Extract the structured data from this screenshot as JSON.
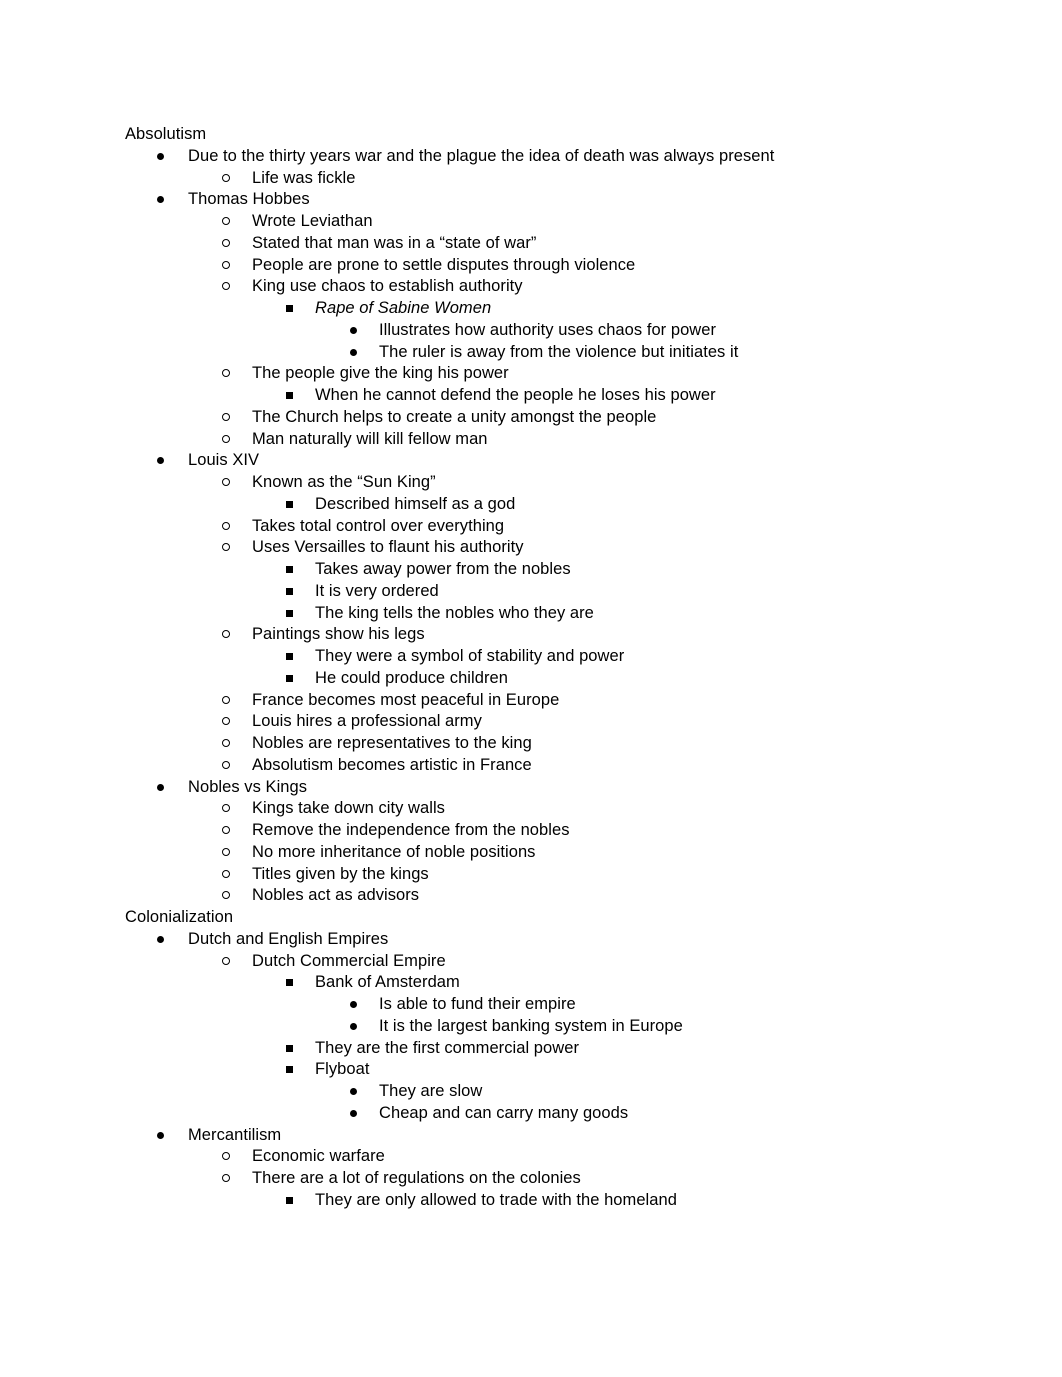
{
  "document": {
    "outline": [
      {
        "level": 0,
        "bullet": "none",
        "text": "Absolutism",
        "italic": false
      },
      {
        "level": 1,
        "bullet": "disc",
        "text": "Due to the thirty years war and the plague the idea of death was always present",
        "italic": false
      },
      {
        "level": 2,
        "bullet": "circle",
        "text": "Life was fickle",
        "italic": false
      },
      {
        "level": 1,
        "bullet": "disc",
        "text": "Thomas Hobbes",
        "italic": false
      },
      {
        "level": 2,
        "bullet": "circle",
        "text": "Wrote Leviathan",
        "italic": false
      },
      {
        "level": 2,
        "bullet": "circle",
        "text": "Stated that man was in a “state of war”",
        "italic": false
      },
      {
        "level": 2,
        "bullet": "circle",
        "text": "People are prone to settle disputes through violence",
        "italic": false
      },
      {
        "level": 2,
        "bullet": "circle",
        "text": "King use chaos to establish authority",
        "italic": false
      },
      {
        "level": 3,
        "bullet": "square",
        "text": "Rape of Sabine Women",
        "italic": true
      },
      {
        "level": 4,
        "bullet": "disc",
        "text": "Illustrates how authority uses chaos for power",
        "italic": false
      },
      {
        "level": 4,
        "bullet": "disc",
        "text": "The ruler is away from the violence but initiates it",
        "italic": false
      },
      {
        "level": 2,
        "bullet": "circle",
        "text": "The people give the king his power",
        "italic": false
      },
      {
        "level": 3,
        "bullet": "square",
        "text": "When he cannot defend the people he loses his power",
        "italic": false
      },
      {
        "level": 2,
        "bullet": "circle",
        "text": "The Church helps to create a unity amongst the people",
        "italic": false
      },
      {
        "level": 2,
        "bullet": "circle",
        "text": "Man naturally will kill fellow man",
        "italic": false
      },
      {
        "level": 1,
        "bullet": "disc",
        "text": "Louis XIV",
        "italic": false
      },
      {
        "level": 2,
        "bullet": "circle",
        "text": "Known as the “Sun King”",
        "italic": false
      },
      {
        "level": 3,
        "bullet": "square",
        "text": "Described himself as a god",
        "italic": false
      },
      {
        "level": 2,
        "bullet": "circle",
        "text": "Takes total control over everything",
        "italic": false
      },
      {
        "level": 2,
        "bullet": "circle",
        "text": "Uses Versailles to flaunt his authority",
        "italic": false
      },
      {
        "level": 3,
        "bullet": "square",
        "text": "Takes away power from the nobles",
        "italic": false
      },
      {
        "level": 3,
        "bullet": "square",
        "text": "It is very ordered",
        "italic": false
      },
      {
        "level": 3,
        "bullet": "square",
        "text": "The king tells the nobles who they are",
        "italic": false
      },
      {
        "level": 2,
        "bullet": "circle",
        "text": "Paintings show his legs",
        "italic": false
      },
      {
        "level": 3,
        "bullet": "square",
        "text": "They were a symbol of stability and power",
        "italic": false
      },
      {
        "level": 3,
        "bullet": "square",
        "text": "He could produce children",
        "italic": false
      },
      {
        "level": 2,
        "bullet": "circle",
        "text": "France becomes most peaceful in Europe",
        "italic": false
      },
      {
        "level": 2,
        "bullet": "circle",
        "text": "Louis hires a professional army",
        "italic": false
      },
      {
        "level": 2,
        "bullet": "circle",
        "text": "Nobles are representatives to the king",
        "italic": false
      },
      {
        "level": 2,
        "bullet": "circle",
        "text": "Absolutism becomes artistic in France",
        "italic": false
      },
      {
        "level": 1,
        "bullet": "disc",
        "text": "Nobles vs Kings",
        "italic": false
      },
      {
        "level": 2,
        "bullet": "circle",
        "text": "Kings take down city walls",
        "italic": false
      },
      {
        "level": 2,
        "bullet": "circle",
        "text": "Remove the independence from the nobles",
        "italic": false
      },
      {
        "level": 2,
        "bullet": "circle",
        "text": "No more inheritance of noble positions",
        "italic": false
      },
      {
        "level": 2,
        "bullet": "circle",
        "text": "Titles given by the kings",
        "italic": false
      },
      {
        "level": 2,
        "bullet": "circle",
        "text": "Nobles act as advisors",
        "italic": false
      },
      {
        "level": 0,
        "bullet": "none",
        "text": "Colonialization",
        "italic": false
      },
      {
        "level": 1,
        "bullet": "disc",
        "text": "Dutch and English Empires",
        "italic": false
      },
      {
        "level": 2,
        "bullet": "circle",
        "text": "Dutch Commercial Empire",
        "italic": false
      },
      {
        "level": 3,
        "bullet": "square",
        "text": "Bank of Amsterdam",
        "italic": false
      },
      {
        "level": 4,
        "bullet": "disc",
        "text": "Is able to fund their empire",
        "italic": false
      },
      {
        "level": 4,
        "bullet": "disc",
        "text": "It is the largest banking system in Europe",
        "italic": false
      },
      {
        "level": 3,
        "bullet": "square",
        "text": "They are the first commercial power",
        "italic": false
      },
      {
        "level": 3,
        "bullet": "square",
        "text": "Flyboat",
        "italic": false
      },
      {
        "level": 4,
        "bullet": "disc",
        "text": "They are slow",
        "italic": false
      },
      {
        "level": 4,
        "bullet": "disc",
        "text": "Cheap and can carry many goods",
        "italic": false
      },
      {
        "level": 1,
        "bullet": "disc",
        "text": "Mercantilism",
        "italic": false
      },
      {
        "level": 2,
        "bullet": "circle",
        "text": "Economic warfare",
        "italic": false
      },
      {
        "level": 2,
        "bullet": "circle",
        "text": "There are a lot of regulations on the colonies",
        "italic": false
      },
      {
        "level": 3,
        "bullet": "square",
        "text": "They are only allowed to trade with the homeland",
        "italic": false
      }
    ]
  }
}
